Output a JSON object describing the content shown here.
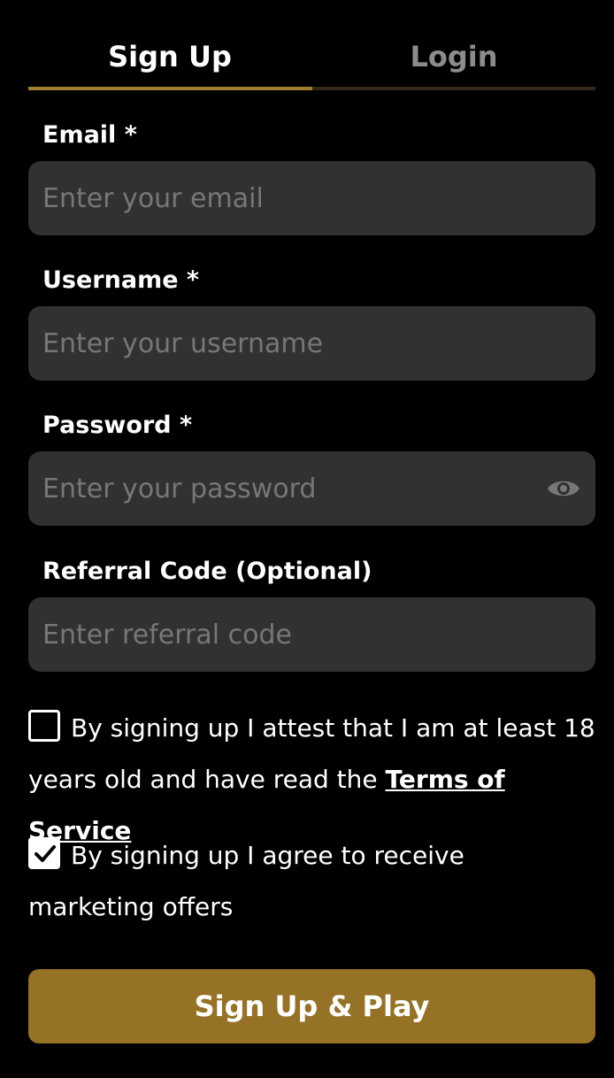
{
  "tabs": {
    "signup_label": "Sign Up",
    "login_label": "Login",
    "active": "Sign Up"
  },
  "form": {
    "email": {
      "label": "Email *",
      "placeholder": "Enter your email",
      "value": ""
    },
    "username": {
      "label": "Username *",
      "placeholder": "Enter your username",
      "value": ""
    },
    "password": {
      "label": "Password *",
      "placeholder": "Enter your password",
      "value": "",
      "toggle_icon": "eye-icon"
    },
    "referral": {
      "label": "Referral Code (Optional)",
      "placeholder": "Enter referral code",
      "value": ""
    }
  },
  "agreements": {
    "age": {
      "checked": false,
      "text": "By signing up I attest that I am at least 18 years old and have read the",
      "link_text": "Terms of Service"
    },
    "marketing": {
      "checked": true,
      "text": "By signing up I agree to receive marketing offers"
    }
  },
  "submit_label": "Sign Up & Play",
  "colors": {
    "background": "#000000",
    "accent": "#957225",
    "tab_underline_active": "#a07f2c",
    "input_bg": "#313131",
    "inactive_tab_text": "#8c8c8c"
  }
}
